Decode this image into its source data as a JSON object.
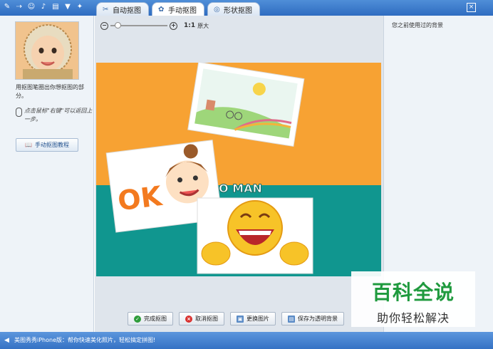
{
  "toolbar": {
    "icons": [
      "skin-icon",
      "share-icon",
      "emoji-icon",
      "mic-icon",
      "keyboard-icon",
      "shirt-icon",
      "tool-icon"
    ]
  },
  "tabs": [
    {
      "label": "自动抠图",
      "icon": "auto-cut-icon"
    },
    {
      "label": "手动抠图",
      "icon": "gear-icon",
      "active": true
    },
    {
      "label": "形状抠图",
      "icon": "shape-icon"
    }
  ],
  "window": {
    "close_glyph": "×"
  },
  "left": {
    "tip": "用抠图笔圈出你想抠图的部分。",
    "hand_tip": "点击鼠标\"右键\"可以返回上一步。",
    "tutorial_button": "手动抠图教程"
  },
  "zoom": {
    "ratio": "1:1",
    "label": "原大",
    "level": 0.08
  },
  "actions": [
    {
      "label": "完成抠图",
      "icon": "check-icon",
      "color": "#2e9c3a"
    },
    {
      "label": "取消抠图",
      "icon": "cancel-icon",
      "color": "#d9312f"
    },
    {
      "label": "更换图片",
      "icon": "image-icon",
      "color": "#5a8bc6"
    },
    {
      "label": "保存为透明背景",
      "icon": "save-icon",
      "color": "#5a8bc6"
    }
  ],
  "right": {
    "title": "您之前使用过的背景"
  },
  "canvas_text": {
    "ok": "OK",
    "man": "O MAN"
  },
  "watermark": {
    "title": "百科全说",
    "subtitle": "助你轻松解决"
  },
  "status": {
    "text": "美图秀秀iPhone版：帮你快速美化照片，轻松搞定拼图!"
  },
  "colors": {
    "orange": "#f7a233",
    "teal": "#10968f",
    "accent": "#2f6cc0"
  }
}
